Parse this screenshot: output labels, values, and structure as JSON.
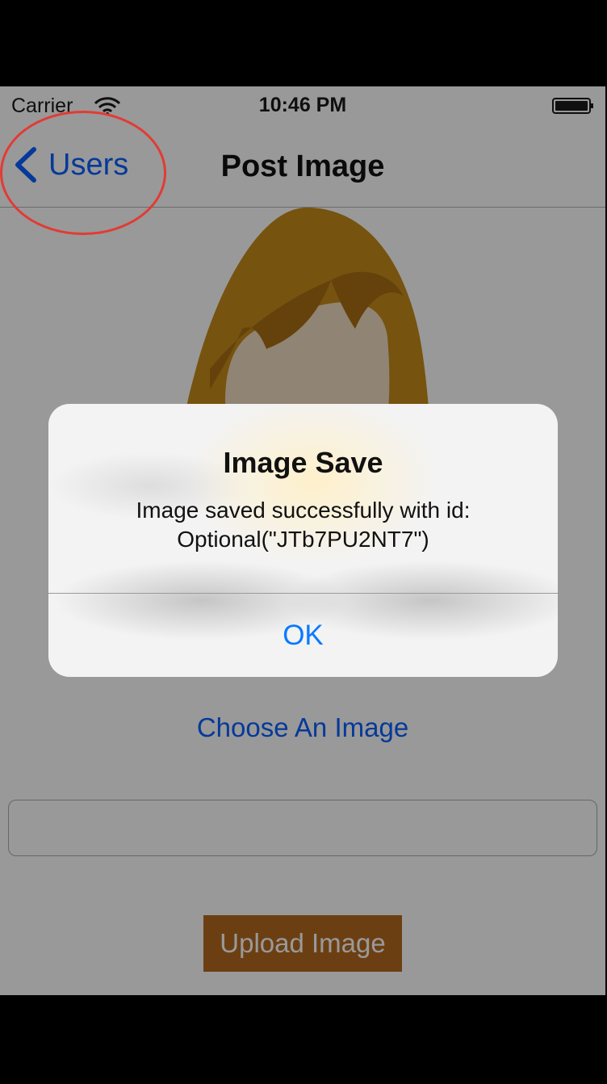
{
  "status_bar": {
    "carrier": "Carrier",
    "time": "10:46 PM",
    "icons": [
      "wifi-icon",
      "battery-icon"
    ]
  },
  "nav": {
    "back_label": "Users",
    "back_icon": "chevron-left-icon",
    "title": "Post Image"
  },
  "content": {
    "avatar_icon": "female-avatar-placeholder",
    "choose_button": "Choose An Image",
    "caption_field_value": "",
    "upload_button": "Upload Image"
  },
  "alert": {
    "title": "Image Save",
    "message_line1": "Image saved successfully with id:",
    "message_line2": "Optional(\"JTb7PU2NT7\")",
    "ok_button": "OK"
  },
  "colors": {
    "tint": "#0a60ff",
    "upload_button_bg": "#b4691e",
    "annotation": "#e23b35"
  }
}
